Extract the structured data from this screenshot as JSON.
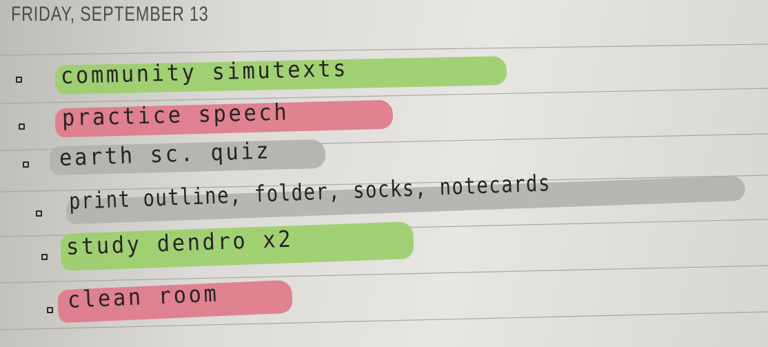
{
  "date_heading": "FRIDAY, SEPTEMBER 13",
  "colors": {
    "green_highlight": "#9ccf6b",
    "pink_highlight": "#e07a8a",
    "gray_highlight": "#b3b2af",
    "ink": "#262423"
  },
  "tasks": [
    {
      "text": "community simutexts",
      "highlight": "green",
      "checked": false
    },
    {
      "text": "practice speech",
      "highlight": "pink",
      "checked": false
    },
    {
      "text": "earth sc. quiz",
      "highlight": "gray",
      "checked": false
    },
    {
      "text": "print outline, folder, socks, notecards",
      "highlight": "gray",
      "checked": false
    },
    {
      "text": "study dendro x2",
      "highlight": "green",
      "checked": false
    },
    {
      "text": "clean room",
      "highlight": "pink",
      "checked": false
    }
  ]
}
